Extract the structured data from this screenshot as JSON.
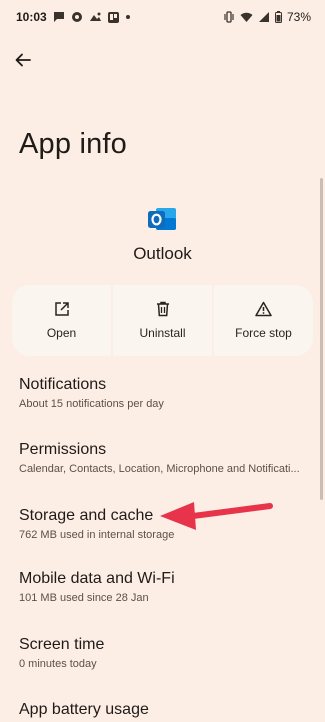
{
  "status_bar": {
    "time": "10:03",
    "battery": "73%",
    "left_icons": [
      "message-icon",
      "chat-icon",
      "photo-icon",
      "trello-icon",
      "dot-icon"
    ],
    "right_icons": [
      "vibrate-icon",
      "wifi-icon",
      "signal-icon",
      "battery-icon"
    ]
  },
  "header": {
    "title": "App info"
  },
  "app": {
    "name": "Outlook",
    "icon": "outlook-icon",
    "brand_color": "#0f6cbd"
  },
  "actions": [
    {
      "label": "Open",
      "icon": "open-external-icon"
    },
    {
      "label": "Uninstall",
      "icon": "trash-icon"
    },
    {
      "label": "Force stop",
      "icon": "warning-icon"
    }
  ],
  "items": [
    {
      "title": "Notifications",
      "subtitle": "About 15 notifications per day"
    },
    {
      "title": "Permissions",
      "subtitle": "Calendar, Contacts, Location, Microphone and Notificati..."
    },
    {
      "title": "Storage and cache",
      "subtitle": "762 MB used in internal storage"
    },
    {
      "title": "Mobile data and Wi-Fi",
      "subtitle": "101 MB used since 28 Jan"
    },
    {
      "title": "Screen time",
      "subtitle": "0 minutes today"
    },
    {
      "title": "App battery usage",
      "subtitle": ""
    }
  ],
  "annotation": {
    "color": "#e8344b",
    "icon": "red-arrow-icon"
  },
  "theme": {
    "background": "#fdeee5",
    "button_bg": "#fbf5f0"
  }
}
